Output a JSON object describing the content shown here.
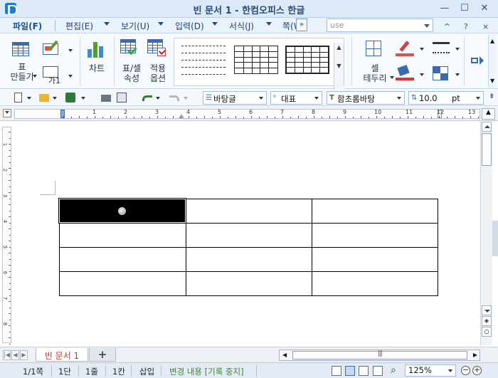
{
  "window": {
    "title": "빈 문서 1 - 한컴오피스 한글",
    "minimize": "—",
    "maximize": "☐",
    "close": "✕"
  },
  "menu": {
    "items": [
      "파일(F)",
      "편집(E)",
      "보기(U)",
      "입력(D)",
      "서식(J)",
      "쪽(W)"
    ],
    "more": "»",
    "search_value": "use",
    "collapse": "^",
    "help": "?",
    "close_doc": "×"
  },
  "ribbon": {
    "table_label": "표\n만들기",
    "text_label": "가1",
    "chart_label": "차트",
    "table_props_label": "표/셀\n속성",
    "apply_options_label": "적용\n옵션",
    "cell_border_label": "셀\n테두리",
    "scroll_up": "▲",
    "scroll_down": "▼"
  },
  "toolbar2": {
    "style_value": "바탕글",
    "outline_value": "대표",
    "font_value": "함초롬바탕",
    "size_value": "10.0",
    "size_unit": "pt"
  },
  "ruler": {
    "numbers": [
      "1",
      "2",
      "3",
      "4",
      "5",
      "6",
      "7",
      "8",
      "9",
      "10",
      "11",
      "12",
      "13",
      "14"
    ]
  },
  "vruler": {
    "numbers": [
      "1",
      "2",
      "3",
      "4",
      "5",
      "6",
      "7",
      "8"
    ]
  },
  "table": {
    "rows": 4,
    "cols": 3,
    "selected_cell": [
      0,
      0
    ]
  },
  "tabs": {
    "active": "빈 문서 1",
    "add": "+"
  },
  "status": {
    "page": "1/1쪽",
    "section": "1단",
    "line": "1줄",
    "col": "1칸",
    "mode": "삽입",
    "track": "변경 내용 [기록 중지]",
    "zoom": "125%",
    "zoom_out": "−",
    "zoom_in": "+"
  },
  "colors": {
    "accent": "#1b4f9c",
    "tab_text": "#c0392b",
    "track_text": "#3a8a2e"
  }
}
